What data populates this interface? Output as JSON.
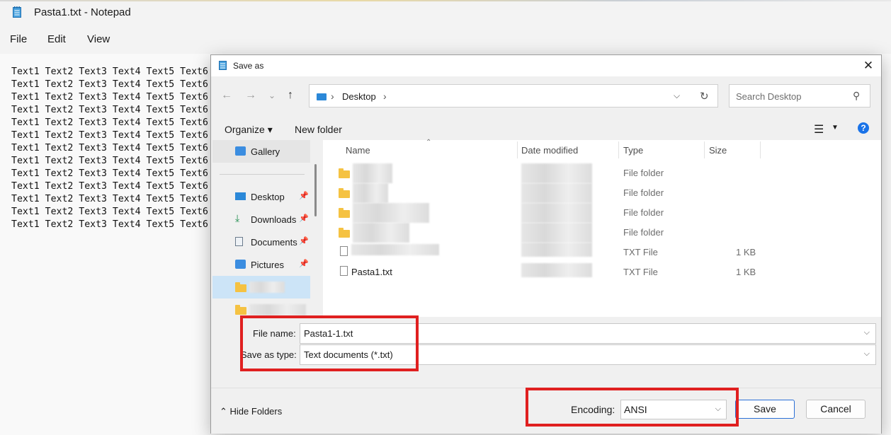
{
  "notepad": {
    "title": "Pasta1.txt - Notepad",
    "menu": [
      "File",
      "Edit",
      "View"
    ],
    "line_text": "Text1 Text2 Text3 Text4 Text5 Text6",
    "line_count": 13
  },
  "dialog": {
    "title": "Save as",
    "close_label": "✕",
    "address": {
      "location": "Desktop"
    },
    "search_placeholder": "Search Desktop",
    "toolbar": {
      "organize": "Organize ▾",
      "new_folder": "New folder",
      "help": "?"
    },
    "nav": [
      {
        "label": "Gallery",
        "icon": "gallery-icon",
        "pinned": false
      },
      {
        "label": "Desktop",
        "icon": "desktop-icon",
        "pinned": true
      },
      {
        "label": "Downloads",
        "icon": "downloads-icon",
        "pinned": true
      },
      {
        "label": "Documents",
        "icon": "documents-icon",
        "pinned": true
      },
      {
        "label": "Pictures",
        "icon": "pictures-icon",
        "pinned": true
      }
    ],
    "columns": {
      "name": "Name",
      "date": "Date modified",
      "type": "Type",
      "size": "Size"
    },
    "files": [
      {
        "name": "",
        "type": "File folder",
        "size": "",
        "kind": "folder"
      },
      {
        "name": "",
        "type": "File folder",
        "size": "",
        "kind": "folder"
      },
      {
        "name": "",
        "type": "File folder",
        "size": "",
        "kind": "folder"
      },
      {
        "name": "",
        "type": "File folder",
        "size": "",
        "kind": "folder"
      },
      {
        "name": "",
        "type": "TXT File",
        "size": "1 KB",
        "kind": "txt"
      },
      {
        "name": "Pasta1.txt",
        "type": "TXT File",
        "size": "1 KB",
        "kind": "txt"
      }
    ],
    "file_name_label": "File name:",
    "file_name_value": "Pasta1-1.txt",
    "save_type_label": "Save as type:",
    "save_type_value": "Text documents (*.txt)",
    "hide_folders": "Hide Folders",
    "encoding_label": "Encoding:",
    "encoding_value": "ANSI",
    "save_button": "Save",
    "cancel_button": "Cancel"
  },
  "colors": {
    "highlight_box": "#e02020",
    "accent": "#1a73e8",
    "folder": "#f5c242"
  }
}
